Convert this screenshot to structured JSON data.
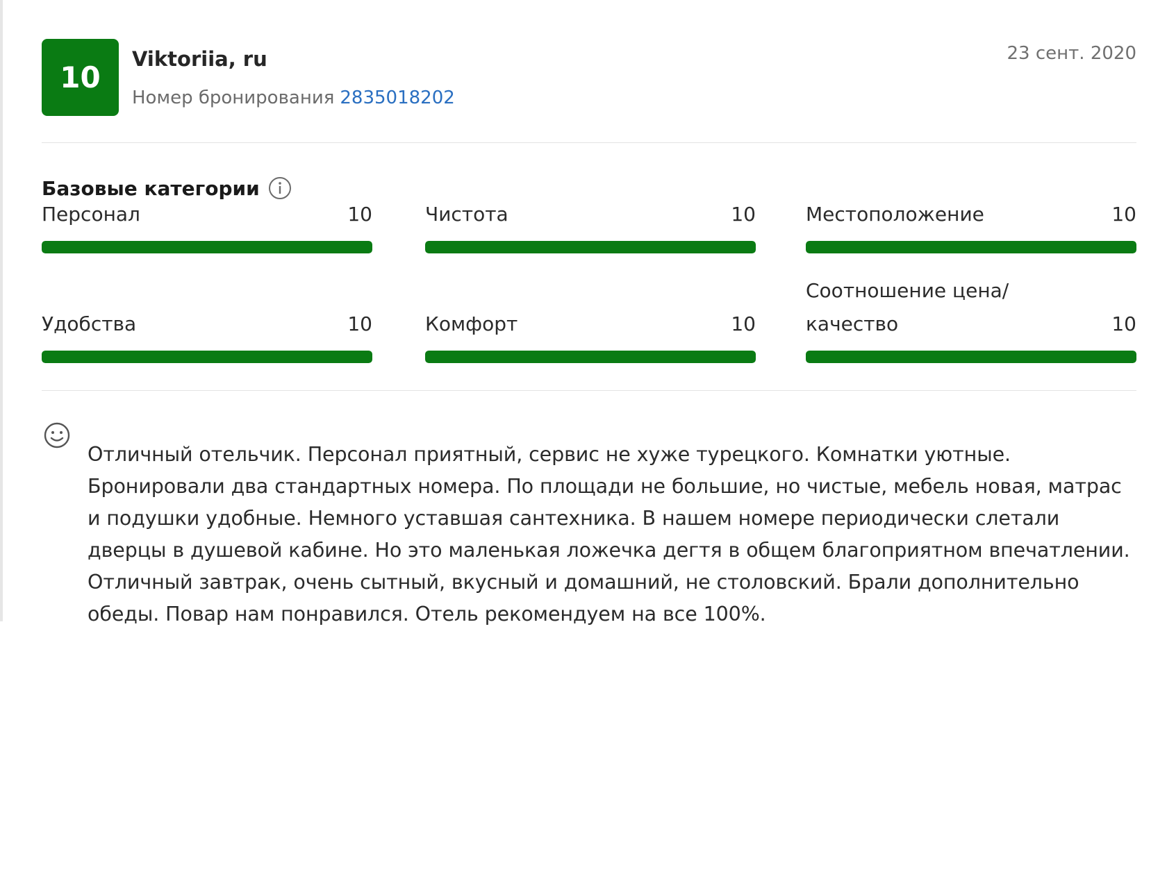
{
  "review": {
    "score": "10",
    "reviewer": "Viktoriia, ru",
    "booking_label": "Номер бронирования",
    "booking_number": "2835018202",
    "date": "23 сент. 2020",
    "categories_title": "Базовые категории",
    "info_icon": "info-icon",
    "categories": [
      {
        "label": "Персонал",
        "value": "10",
        "fill": 1.0
      },
      {
        "label": "Чистота",
        "value": "10",
        "fill": 1.0
      },
      {
        "label": "Местоположение",
        "value": "10",
        "fill": 1.0
      },
      {
        "label": "Удобства",
        "value": "10",
        "fill": 1.0
      },
      {
        "label": "Комфорт",
        "value": "10",
        "fill": 1.0
      },
      {
        "label": "Соотношение цена/ качество",
        "value": "10",
        "fill": 1.0
      }
    ],
    "positive_icon": "smile-icon",
    "text": "Отличный отельчик. Персонал приятный, сервис не хуже турецкого. Комнатки уютные. Бронировали два стандартных номера. По площади не большие, но чистые, мебель новая, матрас и подушки удобные. Немного уставшая сантехника. В нашем номере периодически слетали дверцы в душевой кабине. Но это маленькая ложечка дегтя в общем благоприятном впечатлении. Отличный завтрак, очень сытный, вкусный и домашний, не столовский. Брали дополнительно обеды. Повар нам понравился. Отель рекомендуем на все 100%.",
    "colors": {
      "score_green": "#0a7b13",
      "link_blue": "#2a6fc1"
    }
  }
}
